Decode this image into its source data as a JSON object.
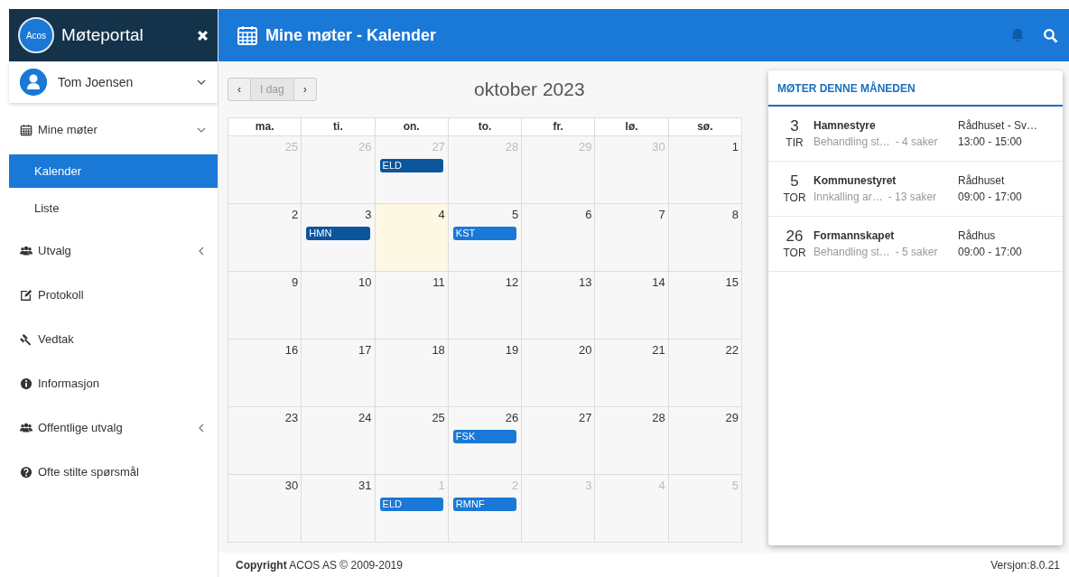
{
  "sidebar": {
    "logo_text": "Acos",
    "brand": "Møteportal",
    "user": "Tom Joensen",
    "items": [
      {
        "label": "Mine møter",
        "expanded": true,
        "children": [
          {
            "label": "Kalender",
            "selected": true
          },
          {
            "label": "Liste",
            "selected": false
          }
        ]
      },
      {
        "label": "Utvalg",
        "expanded": false
      },
      {
        "label": "Protokoll"
      },
      {
        "label": "Vedtak"
      },
      {
        "label": "Informasjon"
      },
      {
        "label": "Offentlige utvalg",
        "expanded": false
      },
      {
        "label": "Ofte stilte spørsmål"
      }
    ]
  },
  "header": {
    "title": "Mine møter - Kalender"
  },
  "calendar": {
    "today_button": "I dag",
    "prev_button": "‹",
    "next_button": "›",
    "title": "oktober 2023",
    "weekdays": [
      "ma.",
      "ti.",
      "on.",
      "to.",
      "fr.",
      "lø.",
      "sø."
    ],
    "weeks": [
      [
        {
          "day": "25",
          "other_month": true,
          "today": false
        },
        {
          "day": "26",
          "other_month": true,
          "today": false
        },
        {
          "day": "27",
          "other_month": true,
          "today": false,
          "events": [
            {
              "label": "ELD",
              "color": "#0b559c"
            }
          ]
        },
        {
          "day": "28",
          "other_month": true,
          "today": false
        },
        {
          "day": "29",
          "other_month": true,
          "today": false
        },
        {
          "day": "30",
          "other_month": true,
          "today": false
        },
        {
          "day": "1",
          "other_month": false,
          "today": false
        }
      ],
      [
        {
          "day": "2",
          "other_month": false,
          "today": false
        },
        {
          "day": "3",
          "other_month": false,
          "today": false,
          "events": [
            {
              "label": "HMN",
              "color": "#0b559c"
            }
          ]
        },
        {
          "day": "4",
          "other_month": false,
          "today": true
        },
        {
          "day": "5",
          "other_month": false,
          "today": false,
          "events": [
            {
              "label": "KST",
              "color": "#1a78d6"
            }
          ]
        },
        {
          "day": "6",
          "other_month": false,
          "today": false
        },
        {
          "day": "7",
          "other_month": false,
          "today": false
        },
        {
          "day": "8",
          "other_month": false,
          "today": false
        }
      ],
      [
        {
          "day": "9",
          "other_month": false,
          "today": false
        },
        {
          "day": "10",
          "other_month": false,
          "today": false
        },
        {
          "day": "11",
          "other_month": false,
          "today": false
        },
        {
          "day": "12",
          "other_month": false,
          "today": false
        },
        {
          "day": "13",
          "other_month": false,
          "today": false
        },
        {
          "day": "14",
          "other_month": false,
          "today": false
        },
        {
          "day": "15",
          "other_month": false,
          "today": false
        }
      ],
      [
        {
          "day": "16",
          "other_month": false,
          "today": false
        },
        {
          "day": "17",
          "other_month": false,
          "today": false
        },
        {
          "day": "18",
          "other_month": false,
          "today": false
        },
        {
          "day": "19",
          "other_month": false,
          "today": false
        },
        {
          "day": "20",
          "other_month": false,
          "today": false
        },
        {
          "day": "21",
          "other_month": false,
          "today": false
        },
        {
          "day": "22",
          "other_month": false,
          "today": false
        }
      ],
      [
        {
          "day": "23",
          "other_month": false,
          "today": false
        },
        {
          "day": "24",
          "other_month": false,
          "today": false
        },
        {
          "day": "25",
          "other_month": false,
          "today": false
        },
        {
          "day": "26",
          "other_month": false,
          "today": false,
          "events": [
            {
              "label": "FSK",
              "color": "#1a78d6"
            }
          ]
        },
        {
          "day": "27",
          "other_month": false,
          "today": false
        },
        {
          "day": "28",
          "other_month": false,
          "today": false
        },
        {
          "day": "29",
          "other_month": false,
          "today": false
        }
      ],
      [
        {
          "day": "30",
          "other_month": false,
          "today": false
        },
        {
          "day": "31",
          "other_month": false,
          "today": false
        },
        {
          "day": "1",
          "other_month": true,
          "today": false,
          "events": [
            {
              "label": "ELD",
              "color": "#1a78d6"
            }
          ]
        },
        {
          "day": "2",
          "other_month": true,
          "today": false,
          "events": [
            {
              "label": "RMNF",
              "color": "#1a78d6"
            }
          ]
        },
        {
          "day": "3",
          "other_month": true,
          "today": false
        },
        {
          "day": "4",
          "other_month": true,
          "today": false
        },
        {
          "day": "5",
          "other_month": true,
          "today": false
        }
      ]
    ]
  },
  "meetings": {
    "title": "MØTER DENNE MÅNEDEN",
    "items": [
      {
        "day": "3",
        "weekday": "TIR",
        "title": "Hamnestyre",
        "summary": "Behandling st…",
        "count": "- 4 saker",
        "location": "Rådhuset - Sv…",
        "time": "13:00 - 15:00"
      },
      {
        "day": "5",
        "weekday": "TOR",
        "title": "Kommunestyret",
        "summary": "Innkalling ar…",
        "count": "- 13 saker",
        "location": "Rådhuset",
        "time": "09:00 - 17:00"
      },
      {
        "day": "26",
        "weekday": "TOR",
        "title": "Formannskapet",
        "summary": "Behandling st…",
        "count": "- 5 saker",
        "location": "Rådhus",
        "time": "09:00 - 17:00"
      }
    ]
  },
  "footer": {
    "copyright": "**Copyright** ACOS AS © 2009-2019",
    "version": "Versjon:8.0.21"
  }
}
